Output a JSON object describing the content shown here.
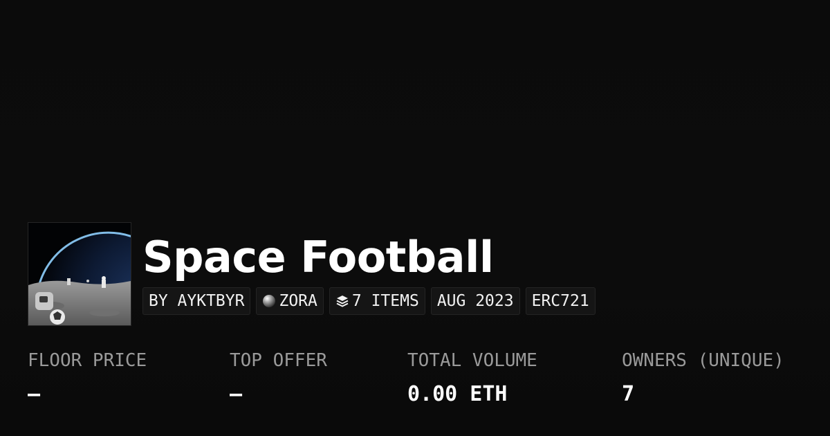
{
  "collection": {
    "title": "Space Football",
    "thumbnail_icon": "space-football-artwork"
  },
  "tags": [
    {
      "label": "BY AYKTBYR",
      "icon": null
    },
    {
      "label": "ZORA",
      "icon": "zora-orb-icon"
    },
    {
      "label": "7 ITEMS",
      "icon": "layers-icon"
    },
    {
      "label": "AUG 2023",
      "icon": null
    },
    {
      "label": "ERC721",
      "icon": null
    }
  ],
  "stats": [
    {
      "label": "FLOOR PRICE",
      "value": "–"
    },
    {
      "label": "TOP OFFER",
      "value": "–"
    },
    {
      "label": "TOTAL VOLUME",
      "value": "0.00 ETH"
    },
    {
      "label": "OWNERS (UNIQUE)",
      "value": "7"
    }
  ],
  "colors": {
    "background": "#0b0b0b",
    "tag_background": "#151515",
    "label_gray": "#9a9a9a",
    "text_white": "#ffffff"
  }
}
